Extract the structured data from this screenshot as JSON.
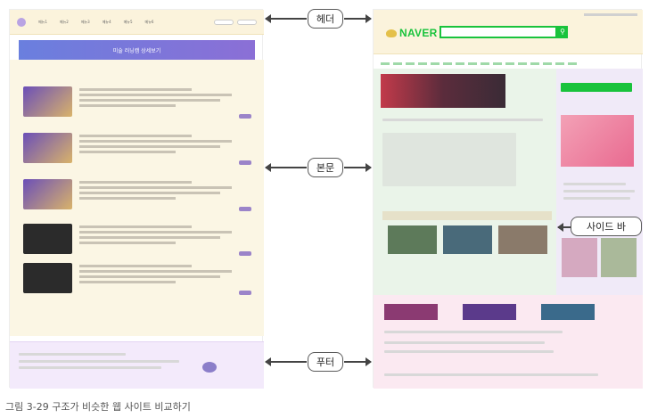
{
  "callouts": {
    "header": "헤더",
    "body": "본문",
    "footer": "푸터",
    "sidebar": "사이드 바"
  },
  "left_site": {
    "banner_title": "미술 러닝캠 상세보기",
    "nav": [
      "메뉴1",
      "메뉴2",
      "메뉴3",
      "메뉴4",
      "메뉴5",
      "메뉴6"
    ]
  },
  "right_site": {
    "logo": "NAVER"
  },
  "caption": "그림 3-29 구조가 비슷한 웹 사이트 비교하기",
  "colors": {
    "header_bg": "#fbf3dc",
    "body_bg": "#fbf6e4",
    "footer_bg": "#f3eafb",
    "sidebar_bg": "#f0eaf8",
    "naver_green": "#19c33c"
  }
}
